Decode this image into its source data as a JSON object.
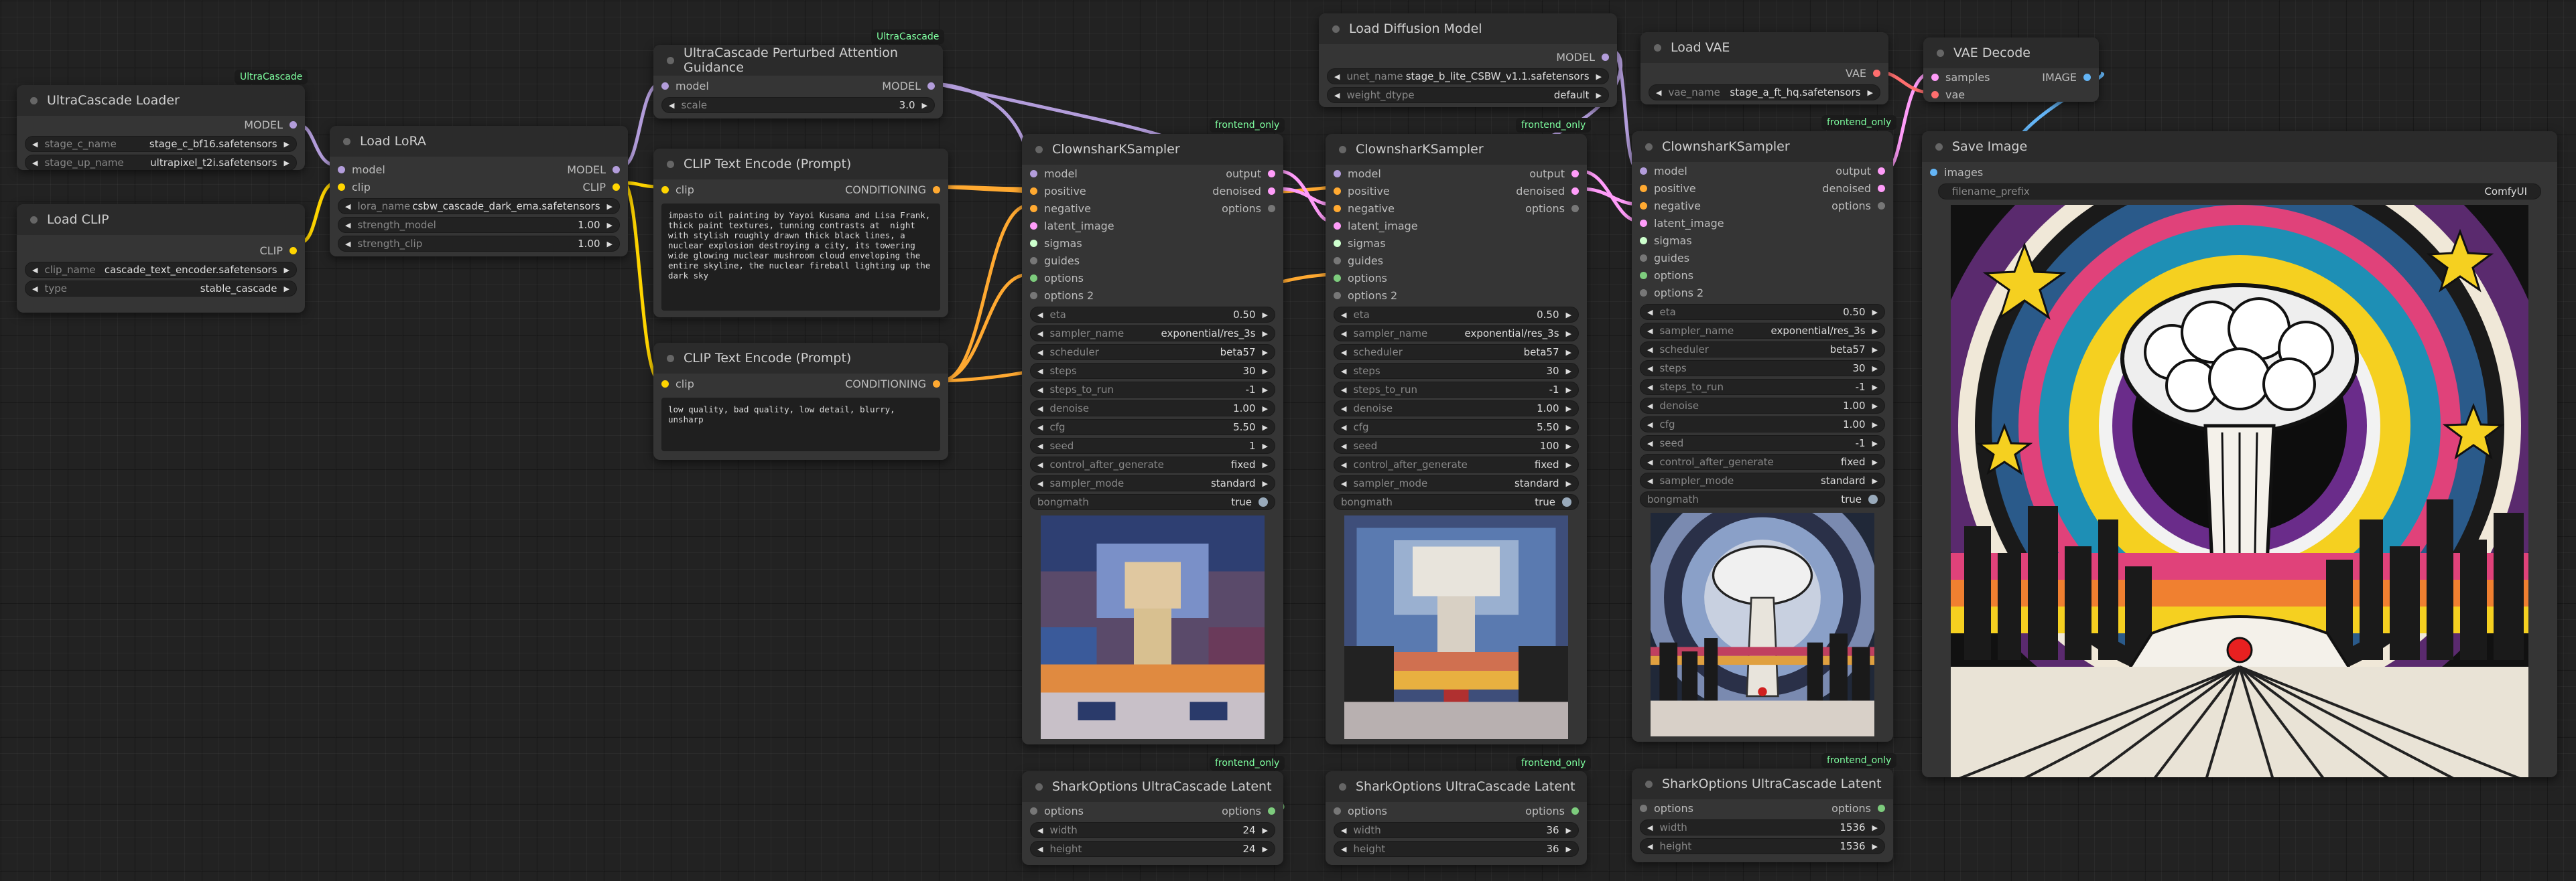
{
  "badges": {
    "ucloader": "UltraCascade",
    "ucpag": "UltraCascade",
    "fo1": "frontend_only",
    "fo2": "frontend_only",
    "fo3": "frontend_only",
    "fo4": "frontend_only",
    "fo5": "frontend_only",
    "fo6": "frontend_only"
  },
  "ucloader": {
    "title": "UltraCascade Loader",
    "out": "MODEL",
    "w": [
      {
        "label": "stage_c_name",
        "value": "stage_c_bf16.safetensors"
      },
      {
        "label": "stage_up_name",
        "value": "ultrapixel_t2i.safetensors"
      }
    ]
  },
  "loadclip": {
    "title": "Load CLIP",
    "out": "CLIP",
    "w": [
      {
        "label": "clip_name",
        "value": "cascade_text_encoder.safetensors"
      },
      {
        "label": "type",
        "value": "stable_cascade"
      }
    ]
  },
  "lora": {
    "title": "Load LoRA",
    "in1": "model",
    "in2": "clip",
    "out1": "MODEL",
    "out2": "CLIP",
    "w": [
      {
        "label": "lora_name",
        "value": "csbw_cascade_dark_ema.safetensors"
      },
      {
        "label": "strength_model",
        "value": "1.00"
      },
      {
        "label": "strength_clip",
        "value": "1.00"
      }
    ]
  },
  "pag": {
    "title": "UltraCascade Perturbed Attention Guidance",
    "in": "model",
    "out": "MODEL",
    "w": [
      {
        "label": "scale",
        "value": "3.0"
      }
    ]
  },
  "clippos": {
    "title": "CLIP Text Encode (Prompt)",
    "in": "clip",
    "out": "CONDITIONING",
    "text": "impasto oil painting by Yayoi Kusama and Lisa Frank, thick paint textures, tunning contrasts at  night with stylish roughly drawn thick black lines, a nuclear explosion destroying a city, its towering wide glowing nuclear mushroom cloud enveloping the entire skyline, the nuclear fireball lighting up the dark sky"
  },
  "clipneg": {
    "title": "CLIP Text Encode (Prompt)",
    "in": "clip",
    "out": "CONDITIONING",
    "text": "low quality, bad quality, low detail, blurry, unsharp"
  },
  "difmodel": {
    "title": "Load Diffusion Model",
    "out": "MODEL",
    "w": [
      {
        "label": "unet_name",
        "value": "stage_b_lite_CSBW_v1.1.safetensors"
      },
      {
        "label": "weight_dtype",
        "value": "default"
      }
    ]
  },
  "vae": {
    "title": "Load VAE",
    "out": "VAE",
    "w": [
      {
        "label": "vae_name",
        "value": "stage_a_ft_hq.safetensors"
      }
    ]
  },
  "vaedecode": {
    "title": "VAE Decode",
    "in1": "samples",
    "in2": "vae",
    "out": "IMAGE"
  },
  "save": {
    "title": "Save Image",
    "in": "images",
    "w": [
      {
        "label": "filename_prefix",
        "value": "ComfyUI"
      }
    ]
  },
  "ksampler_io": {
    "title": "ClownsharKSampler",
    "inputs": [
      "model",
      "positive",
      "negative",
      "latent_image",
      "sigmas",
      "guides",
      "options",
      "options 2"
    ],
    "outputs": [
      "output",
      "denoised",
      "options"
    ]
  },
  "ks1": {
    "w": [
      {
        "label": "eta",
        "value": "0.50"
      },
      {
        "label": "sampler_name",
        "value": "exponential/res_3s"
      },
      {
        "label": "scheduler",
        "value": "beta57"
      },
      {
        "label": "steps",
        "value": "30"
      },
      {
        "label": "steps_to_run",
        "value": "-1"
      },
      {
        "label": "denoise",
        "value": "1.00"
      },
      {
        "label": "cfg",
        "value": "5.50"
      },
      {
        "label": "seed",
        "value": "1"
      },
      {
        "label": "control_after_generate",
        "value": "fixed"
      },
      {
        "label": "sampler_mode",
        "value": "standard"
      }
    ],
    "bongmath": {
      "label": "bongmath",
      "value": "true"
    }
  },
  "ks2": {
    "w": [
      {
        "label": "eta",
        "value": "0.50"
      },
      {
        "label": "sampler_name",
        "value": "exponential/res_3s"
      },
      {
        "label": "scheduler",
        "value": "beta57"
      },
      {
        "label": "steps",
        "value": "30"
      },
      {
        "label": "steps_to_run",
        "value": "-1"
      },
      {
        "label": "denoise",
        "value": "1.00"
      },
      {
        "label": "cfg",
        "value": "5.50"
      },
      {
        "label": "seed",
        "value": "100"
      },
      {
        "label": "control_after_generate",
        "value": "fixed"
      },
      {
        "label": "sampler_mode",
        "value": "standard"
      }
    ],
    "bongmath": {
      "label": "bongmath",
      "value": "true"
    }
  },
  "ks3": {
    "w": [
      {
        "label": "eta",
        "value": "0.50"
      },
      {
        "label": "sampler_name",
        "value": "exponential/res_3s"
      },
      {
        "label": "scheduler",
        "value": "beta57"
      },
      {
        "label": "steps",
        "value": "30"
      },
      {
        "label": "steps_to_run",
        "value": "-1"
      },
      {
        "label": "denoise",
        "value": "1.00"
      },
      {
        "label": "cfg",
        "value": "1.00"
      },
      {
        "label": "seed",
        "value": "-1"
      },
      {
        "label": "control_after_generate",
        "value": "fixed"
      },
      {
        "label": "sampler_mode",
        "value": "standard"
      }
    ],
    "bongmath": {
      "label": "bongmath",
      "value": "true"
    }
  },
  "shark": {
    "title": "SharkOptions UltraCascade Latent",
    "in": "options",
    "out": "options"
  },
  "sh1": {
    "w": [
      {
        "label": "width",
        "value": "24"
      },
      {
        "label": "height",
        "value": "24"
      }
    ]
  },
  "sh2": {
    "w": [
      {
        "label": "width",
        "value": "36"
      },
      {
        "label": "height",
        "value": "36"
      }
    ]
  },
  "sh3": {
    "w": [
      {
        "label": "width",
        "value": "1536"
      },
      {
        "label": "height",
        "value": "1536"
      }
    ]
  },
  "colors": {
    "model": "#b39ddb",
    "clip": "#ffd500",
    "conditioning": "#ffa931",
    "latent": "#ff9cf9",
    "vae": "#ff6e6e",
    "image": "#64b5f6",
    "node_bg": "#353535",
    "title_bg": "#2b2b2b",
    "badge_text": "#7fffa0"
  }
}
